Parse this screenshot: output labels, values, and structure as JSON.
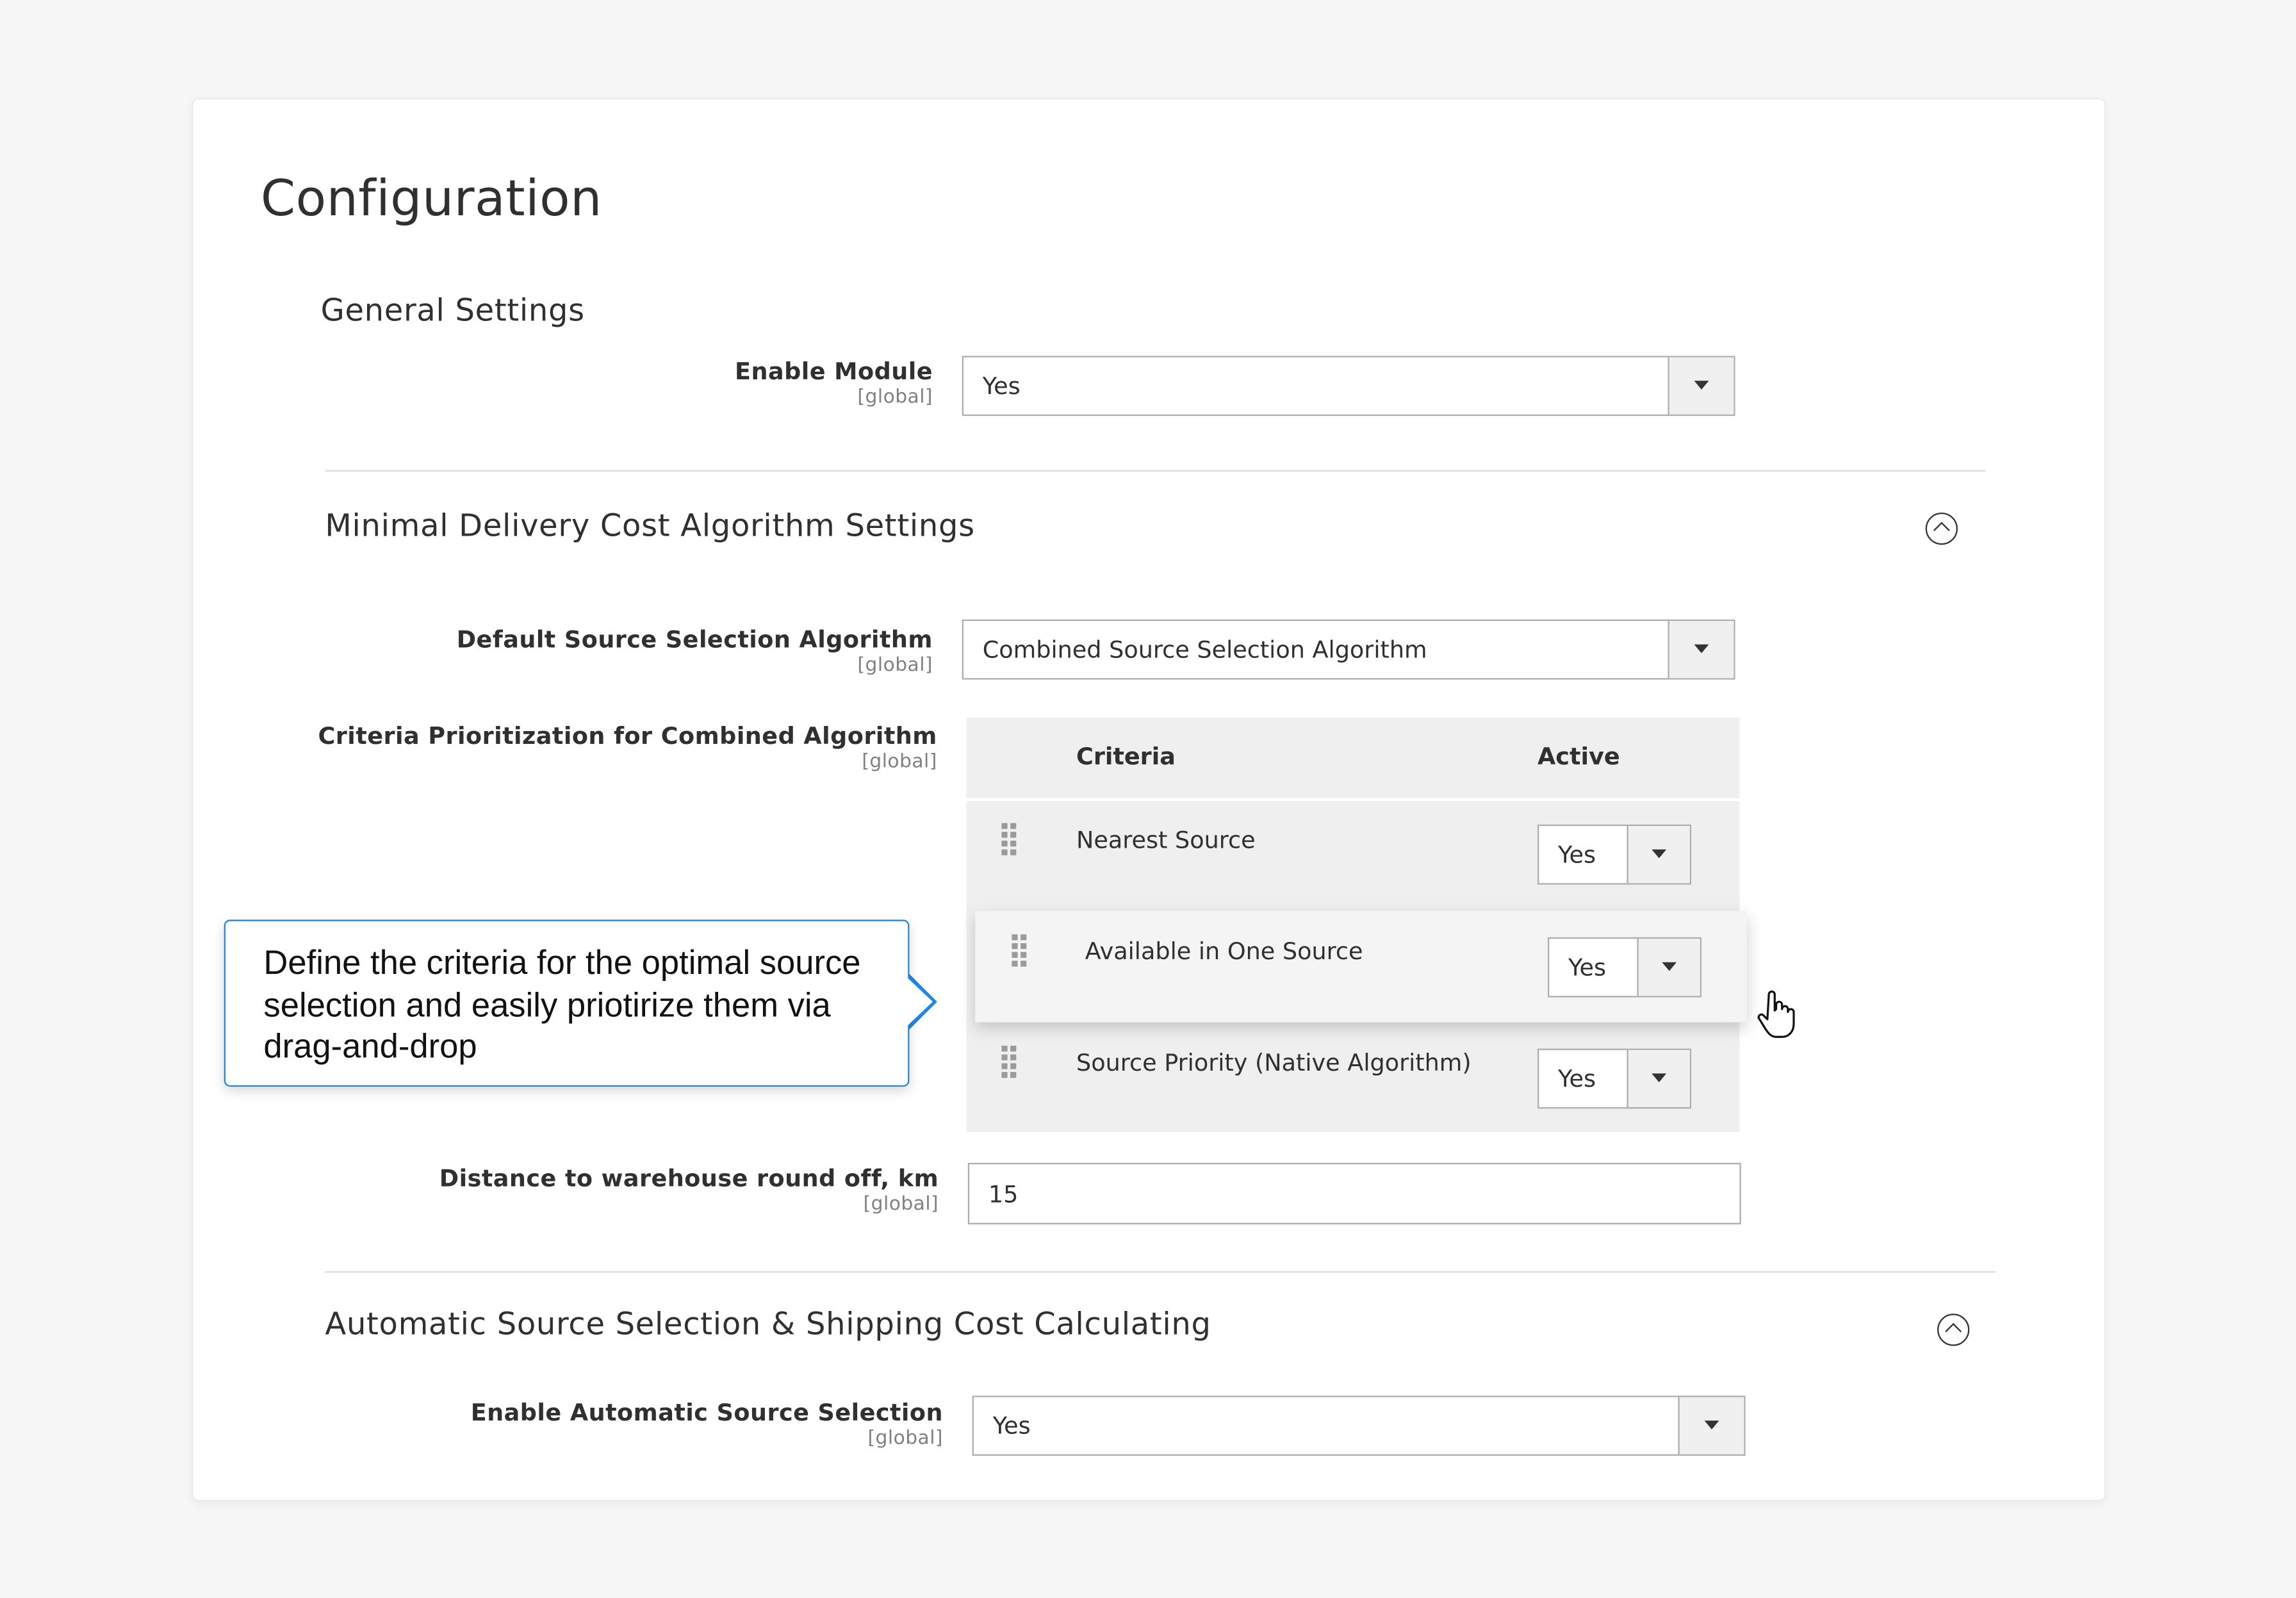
{
  "page": {
    "title": "Configuration"
  },
  "general": {
    "title": "General Settings",
    "enable_module": {
      "label": "Enable Module",
      "scope": "[global]",
      "value": "Yes"
    }
  },
  "minimal": {
    "title": "Minimal Delivery Cost Algorithm Settings",
    "default_algo": {
      "label": "Default Source Selection Algorithm",
      "scope": "[global]",
      "value": "Combined Source Selection Algorithm"
    },
    "criteria": {
      "label": "Criteria Prioritization for Combined Algorithm",
      "scope": "[global]",
      "headers": {
        "criteria": "Criteria",
        "active": "Active"
      },
      "rows": [
        {
          "name": "Nearest Source",
          "active": "Yes"
        },
        {
          "name": "Available in One Source",
          "active": "Yes"
        },
        {
          "name": "Source Priority (Native Algorithm)",
          "active": "Yes"
        }
      ]
    },
    "distance": {
      "label": "Distance to warehouse round off, km",
      "scope": "[global]",
      "value": "15"
    }
  },
  "automatic": {
    "title": "Automatic Source Selection & Shipping Cost Calculating",
    "enable_auto": {
      "label": "Enable Automatic Source Selection",
      "scope": "[global]",
      "value": "Yes"
    }
  },
  "callout": {
    "text": "Define the criteria for the optimal source selection and easily priotirize them via drag-and-drop"
  },
  "icons": {
    "collapse": "chevron-up-circle-icon",
    "drag": "drag-handle-icon",
    "cursor": "hand-pointer-icon",
    "dropdown": "triangle-down-icon"
  },
  "colors": {
    "callout_border": "#1e88e5"
  }
}
